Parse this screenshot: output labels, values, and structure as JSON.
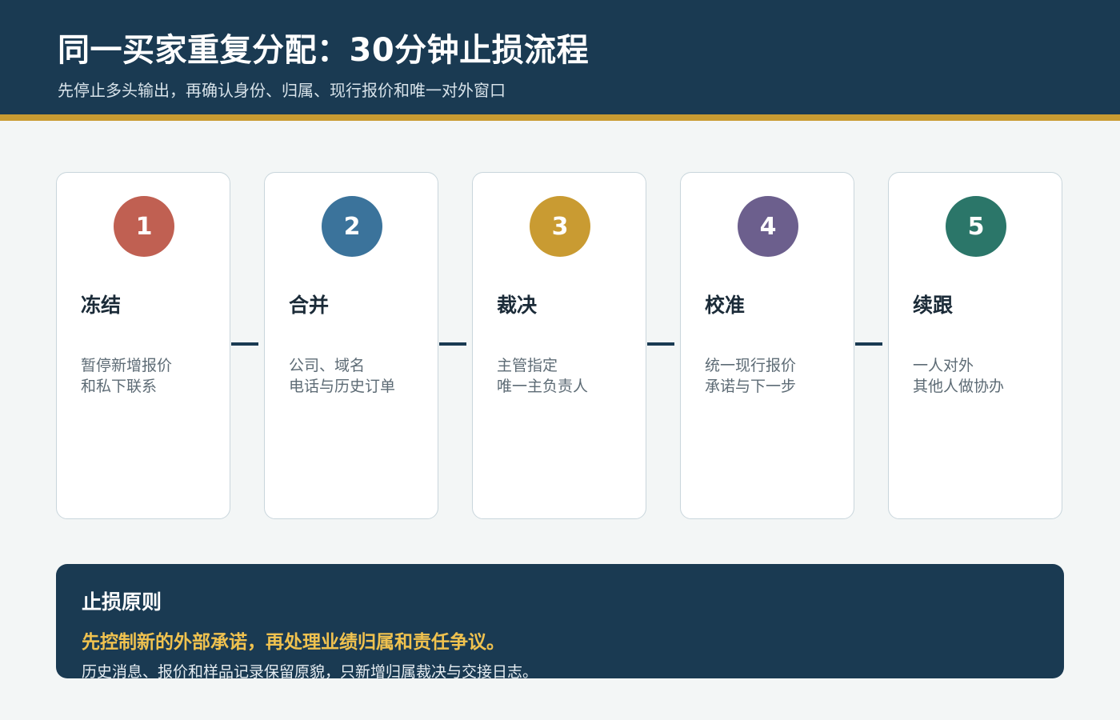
{
  "header": {
    "title": "同一买家重复分配：30分钟止损流程",
    "subtitle": "先停止多头输出，再确认身份、归属、现行报价和唯一对外窗口"
  },
  "steps": [
    {
      "number": "1",
      "title": "冻结",
      "desc_line1": "暂停新增报价",
      "desc_line2": "和私下联系",
      "color": "#c06052"
    },
    {
      "number": "2",
      "title": "合并",
      "desc_line1": "公司、域名",
      "desc_line2": "电话与历史订单",
      "color": "#3b739b"
    },
    {
      "number": "3",
      "title": "裁决",
      "desc_line1": "主管指定",
      "desc_line2": "唯一主负责人",
      "color": "#c99b32"
    },
    {
      "number": "4",
      "title": "校准",
      "desc_line1": "统一现行报价",
      "desc_line2": "承诺与下一步",
      "color": "#6c5f8d"
    },
    {
      "number": "5",
      "title": "续跟",
      "desc_line1": "一人对外",
      "desc_line2": "其他人做协办",
      "color": "#2b7669"
    }
  ],
  "principle": {
    "title": "止损原则",
    "highlight": "先控制新的外部承诺，再处理业绩归属和责任争议。",
    "note": "历史消息、报价和样品记录保留原貌，只新增归属裁决与交接日志。"
  },
  "colors": {
    "header_bg": "#1a3a52",
    "accent_stripe": "#c99b32",
    "highlight_text": "#f0c24f"
  }
}
